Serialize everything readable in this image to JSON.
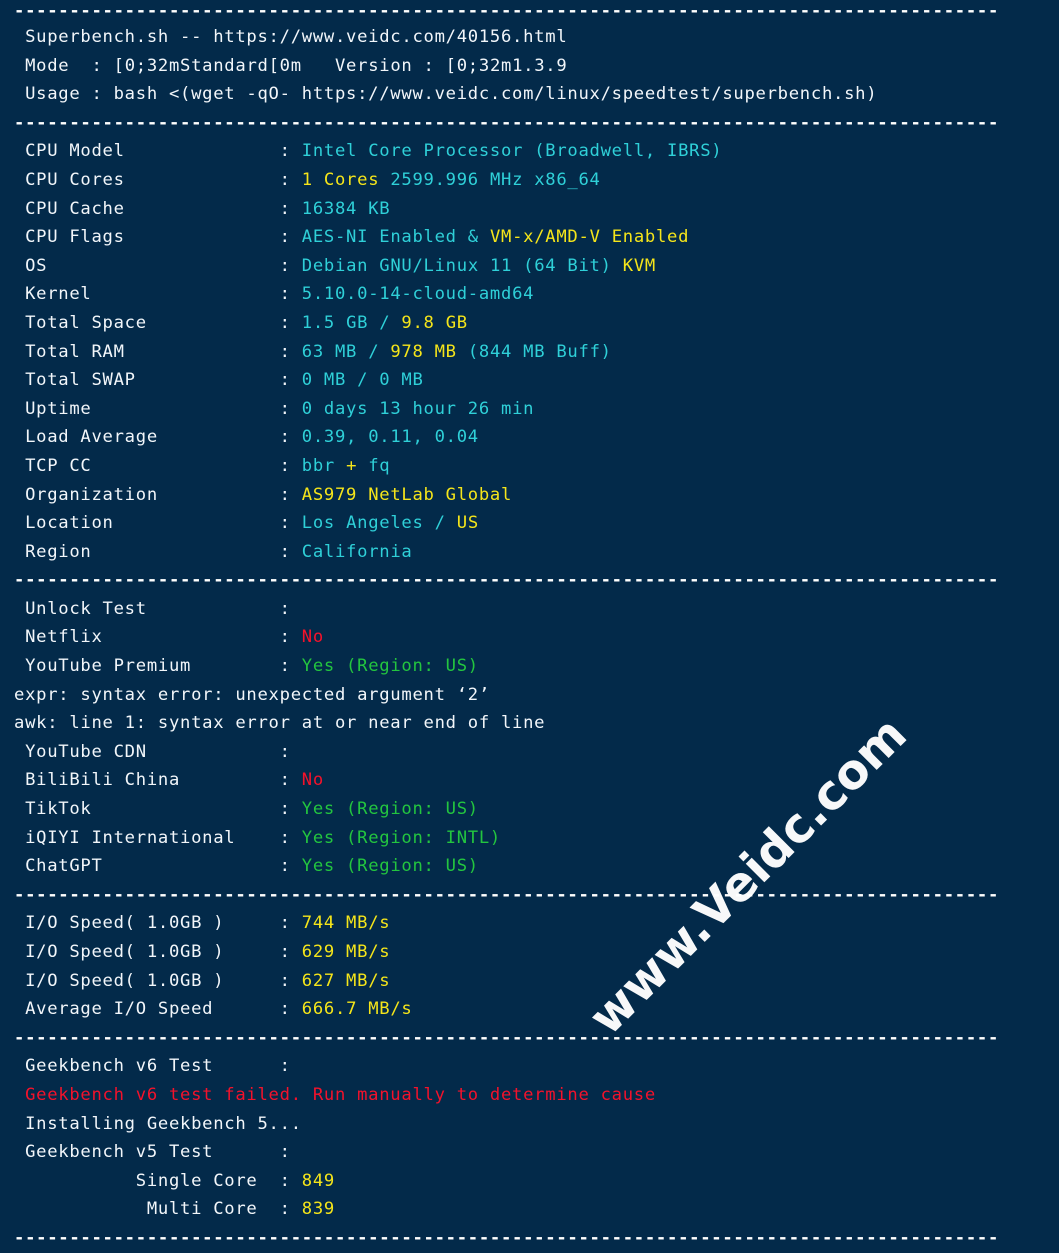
{
  "terminal": {
    "background_color": "#032a4a",
    "separator": "-----------------------------------------------------------------------------------------",
    "colors": {
      "label": "#f2f6fa",
      "value_cyan": "#2fd0d8",
      "value_yellow": "#f5e51a",
      "value_green": "#23c53f",
      "value_red": "#f3122b",
      "separator": "#ffffff"
    }
  },
  "header": {
    "title": "Superbench.sh -- https://www.veidc.com/40156.html",
    "mode_label": "Mode  : ",
    "mode_value": "[0;32mStandard[0m",
    "version_label": "   Version : ",
    "version_value": "[0;32m1.3.9",
    "usage_label": "Usage : ",
    "usage_value": "bash <(wget -qO- https://www.veidc.com/linux/speedtest/superbench.sh)"
  },
  "system_info": [
    {
      "label": "CPU Model",
      "parts": [
        {
          "t": "Intel Core Processor (Broadwell, IBRS)",
          "c": "cyan"
        }
      ]
    },
    {
      "label": "CPU Cores",
      "parts": [
        {
          "t": "1 Cores",
          "c": "yellow"
        },
        {
          "t": " 2599.996 MHz x86_64",
          "c": "cyan"
        }
      ]
    },
    {
      "label": "CPU Cache",
      "parts": [
        {
          "t": "16384 KB",
          "c": "cyan"
        }
      ]
    },
    {
      "label": "CPU Flags",
      "parts": [
        {
          "t": "AES-NI Enabled",
          "c": "cyan"
        },
        {
          "t": " & ",
          "c": "cyan"
        },
        {
          "t": "VM-x/AMD-V Enabled",
          "c": "yellow"
        }
      ]
    },
    {
      "label": "OS",
      "parts": [
        {
          "t": "Debian GNU/Linux 11 (64 Bit) ",
          "c": "cyan"
        },
        {
          "t": "KVM",
          "c": "yellow"
        }
      ]
    },
    {
      "label": "Kernel",
      "parts": [
        {
          "t": "5.10.0-14-cloud-amd64",
          "c": "cyan"
        }
      ]
    },
    {
      "label": "Total Space",
      "parts": [
        {
          "t": "1.5 GB ",
          "c": "cyan"
        },
        {
          "t": "/ ",
          "c": "cyan"
        },
        {
          "t": "9.8 GB",
          "c": "yellow"
        }
      ]
    },
    {
      "label": "Total RAM",
      "parts": [
        {
          "t": "63 MB / ",
          "c": "cyan"
        },
        {
          "t": "978 MB",
          "c": "yellow"
        },
        {
          "t": " (844 MB Buff)",
          "c": "cyan"
        }
      ]
    },
    {
      "label": "Total SWAP",
      "parts": [
        {
          "t": "0 MB / 0 MB",
          "c": "cyan"
        }
      ]
    },
    {
      "label": "Uptime",
      "parts": [
        {
          "t": "0 days 13 hour 26 min",
          "c": "cyan"
        }
      ]
    },
    {
      "label": "Load Average",
      "parts": [
        {
          "t": "0.39, 0.11, 0.04",
          "c": "cyan"
        }
      ]
    },
    {
      "label": "TCP CC",
      "parts": [
        {
          "t": "bbr",
          "c": "cyan"
        },
        {
          "t": " + ",
          "c": "yellow"
        },
        {
          "t": "fq",
          "c": "cyan"
        }
      ]
    },
    {
      "label": "Organization",
      "parts": [
        {
          "t": "AS979 NetLab Global",
          "c": "yellow"
        }
      ]
    },
    {
      "label": "Location",
      "parts": [
        {
          "t": "Los Angeles / ",
          "c": "cyan"
        },
        {
          "t": "US",
          "c": "yellow"
        }
      ]
    },
    {
      "label": "Region",
      "parts": [
        {
          "t": "California",
          "c": "cyan"
        }
      ]
    }
  ],
  "unlock_test": [
    {
      "label": "Unlock Test",
      "parts": []
    },
    {
      "label": "Netflix",
      "parts": [
        {
          "t": "No",
          "c": "red"
        }
      ]
    },
    {
      "label": "YouTube Premium",
      "parts": [
        {
          "t": "Yes (Region: US)",
          "c": "green"
        }
      ]
    }
  ],
  "errors": [
    "expr: syntax error: unexpected argument ‘2’",
    "awk: line 1: syntax error at or near end of line"
  ],
  "unlock_test_2": [
    {
      "label": "YouTube CDN",
      "parts": []
    },
    {
      "label": "BiliBili China",
      "parts": [
        {
          "t": "No",
          "c": "red"
        }
      ]
    },
    {
      "label": "TikTok",
      "parts": [
        {
          "t": "Yes (Region: US)",
          "c": "green"
        }
      ]
    },
    {
      "label": "iQIYI International",
      "parts": [
        {
          "t": "Yes (Region: INTL)",
          "c": "green"
        }
      ]
    },
    {
      "label": "ChatGPT",
      "parts": [
        {
          "t": "Yes (Region: US)",
          "c": "green"
        }
      ]
    }
  ],
  "io_speed": [
    {
      "label": "I/O Speed( 1.0GB )",
      "parts": [
        {
          "t": "744 MB/s",
          "c": "yellow"
        }
      ]
    },
    {
      "label": "I/O Speed( 1.0GB )",
      "parts": [
        {
          "t": "629 MB/s",
          "c": "yellow"
        }
      ]
    },
    {
      "label": "I/O Speed( 1.0GB )",
      "parts": [
        {
          "t": "627 MB/s",
          "c": "yellow"
        }
      ]
    },
    {
      "label": "Average I/O Speed",
      "parts": [
        {
          "t": "666.7 MB/s",
          "c": "yellow"
        }
      ]
    }
  ],
  "geekbench": {
    "v6_label": "Geekbench v6 Test",
    "v6_failed": "Geekbench v6 test failed. Run manually to determine cause",
    "installing": "Installing Geekbench 5...",
    "v5_label": "Geekbench v5 Test",
    "scores": [
      {
        "label": "Single Core",
        "parts": [
          {
            "t": "849",
            "c": "yellow"
          }
        ]
      },
      {
        "label": "Multi Core",
        "parts": [
          {
            "t": "839",
            "c": "yellow"
          }
        ]
      }
    ]
  },
  "watermark": {
    "text": "www.Veidc.com"
  }
}
